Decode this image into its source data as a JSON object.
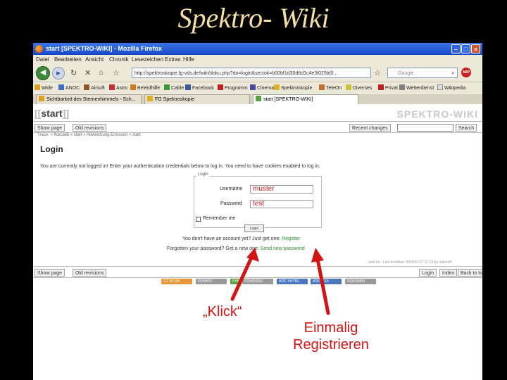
{
  "slide": {
    "title": "Spektro- Wiki"
  },
  "window": {
    "title": "start [SPEKTRO-WIKI] - Mozilla Firefox"
  },
  "menu": [
    "Datei",
    "Bearbeiten",
    "Ansicht",
    "Chronik",
    "Lesezeichen",
    "Extras",
    "Hilfe"
  ],
  "nav": {
    "url": "http://spektroskopie.fg-vds.de/wiki/doku.php?do=login&sectok=b00bf1d30d6d1c4e3f025bf0...",
    "search_placeholder": "Google",
    "abp_label": "ABP"
  },
  "bookmarks": [
    "Wide",
    "ANOC",
    "Airsoft",
    "Astro",
    "Beleidhilfe",
    "Cable",
    "Facebook",
    "Programm",
    "Cinema",
    "Spektroskopie",
    "TeleOn",
    "Diverses",
    "Privat",
    "Wetterdienst",
    "Wikipedia"
  ],
  "tabs": [
    "Sichtbarkeit des Sternenhimmels - Sch...",
    "FG Spektroskopie",
    "start [SPEKTRO-WIKI]"
  ],
  "wiki": {
    "page_name": "start",
    "brand": "SPEKTRO-WIKI",
    "show_page": "Show page",
    "old_revisions": "Old revisions",
    "recent_changes": "Recent changes",
    "search_button": "Search",
    "breadcrumb": "Trace: » fluxcalib » start » Abweichung Emission » start",
    "login_heading": "Login",
    "login_message": "You are currently not logged in! Enter your authentication credentials below to log in. You need to have cookies enabled to log in.",
    "legend": "Login",
    "username_label": "Username",
    "username_value": "muster",
    "password_label": "Password",
    "password_value": "test",
    "remember_label": "Remember me",
    "login_button": "Login",
    "no_account_text": "You don't have an account yet? Just get one: ",
    "register_link": "Register",
    "forgot_text": "Forgotten your password? Get a new one: ",
    "new_password_link": "Send new password",
    "last_modified": "start.txt · Last modified: 2009/01/17 21:23 by maxhoff",
    "bottom_show_page": "Show page",
    "bottom_old_revisions": "Old revisions",
    "bottom_login": "Login",
    "bottom_index": "Index",
    "bottom_back_to_top": "Back to top"
  },
  "badges": [
    {
      "label": "CC BY-SA",
      "color": "#e8963a"
    },
    {
      "label": "DONATE",
      "color": "#9a9a9a"
    },
    {
      "label": "PHP",
      "color": "#5aa043"
    },
    {
      "label": "POWERED",
      "color": "#9a9a9a"
    },
    {
      "label": "W3C XHTML",
      "color": "#4a78c0"
    },
    {
      "label": "W3C CSS",
      "color": "#4a78c0"
    },
    {
      "label": "DOKUWIKI",
      "color": "#9a9a9a"
    }
  ],
  "annotations": {
    "click": "„Klick“",
    "register_line1": "Einmalig",
    "register_line2": "Registrieren"
  },
  "colors": {
    "annotation": "#d11414",
    "slide_title": "#f3dfa3",
    "link": "#2a8a2a"
  }
}
